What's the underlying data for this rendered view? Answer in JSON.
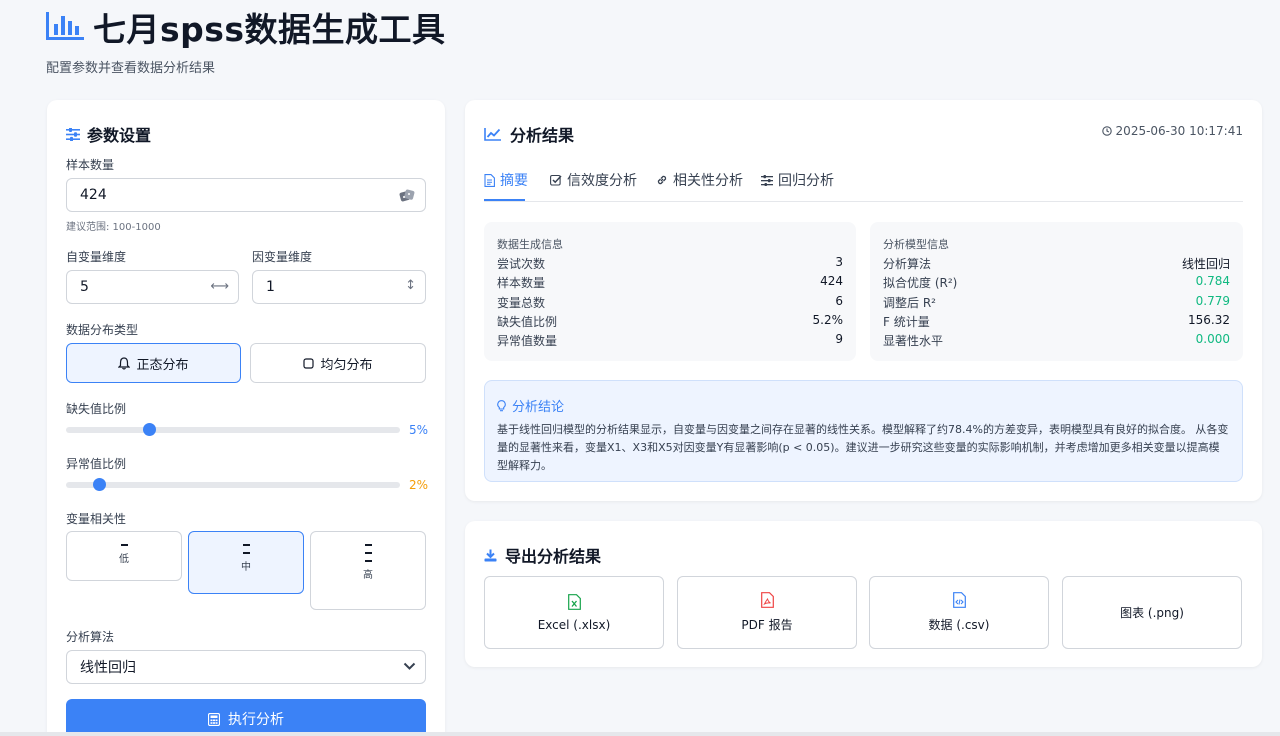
{
  "header": {
    "title": "七月spss数据生成工具",
    "subtitle": "配置参数并查看数据分析结果"
  },
  "params": {
    "title": "参数设置",
    "sample_label": "样本数量",
    "sample_value": "424",
    "sample_hint": "建议范围: 100-1000",
    "indep_label": "自变量维度",
    "indep_value": "5",
    "dep_label": "因变量维度",
    "dep_value": "1",
    "dist_label": "数据分布类型",
    "dist_options": [
      "正态分布",
      "均匀分布"
    ],
    "missing_label": "缺失值比例",
    "missing_value": "5%",
    "missing_fraction": 0.05,
    "outlier_label": "异常值比例",
    "outlier_value": "2%",
    "outlier_fraction": 0.02,
    "corr_label": "变量相关性",
    "corr_options": [
      "低",
      "中",
      "高"
    ],
    "algo_label": "分析算法",
    "algo_value": "线性回归",
    "run_label": "执行分析"
  },
  "results": {
    "title": "分析结果",
    "timestamp": "2025-06-30 10:17:41",
    "tabs": [
      "摘要",
      "信效度分析",
      "相关性分析",
      "回归分析"
    ],
    "gen_info": {
      "title": "数据生成信息",
      "rows": [
        {
          "label": "尝试次数",
          "value": "3"
        },
        {
          "label": "样本数量",
          "value": "424"
        },
        {
          "label": "变量总数",
          "value": "6"
        },
        {
          "label": "缺失值比例",
          "value": "5.2%"
        },
        {
          "label": "异常值数量",
          "value": "9"
        }
      ]
    },
    "model_info": {
      "title": "分析模型信息",
      "rows": [
        {
          "label": "分析算法",
          "value": "线性回归",
          "green": false
        },
        {
          "label": "拟合优度 (R²)",
          "value": "0.784",
          "green": true
        },
        {
          "label": "调整后 R²",
          "value": "0.779",
          "green": true
        },
        {
          "label": "F 统计量",
          "value": "156.32",
          "green": false
        },
        {
          "label": "显著性水平",
          "value": "0.000",
          "green": true
        }
      ]
    },
    "conclusion_title": "分析结论",
    "conclusion_text": "基于线性回归模型的分析结果显示，自变量与因变量之间存在显著的线性关系。模型解释了约78.4%的方差变异，表明模型具有良好的拟合度。 从各变量的显著性来看，变量X1、X3和X5对因变量Y有显著影响(p < 0.05)。建议进一步研究这些变量的实际影响机制，并考虑增加更多相关变量以提高模型解释力。"
  },
  "export": {
    "title": "导出分析结果",
    "buttons": [
      "Excel (.xlsx)",
      "PDF 报告",
      "数据 (.csv)",
      "图表 (.png)"
    ]
  },
  "colors": {
    "accent": "#3b82f6",
    "good": "#10b981",
    "warn": "#f59e0b",
    "excel": "#16a34a",
    "pdf": "#ef4444"
  }
}
